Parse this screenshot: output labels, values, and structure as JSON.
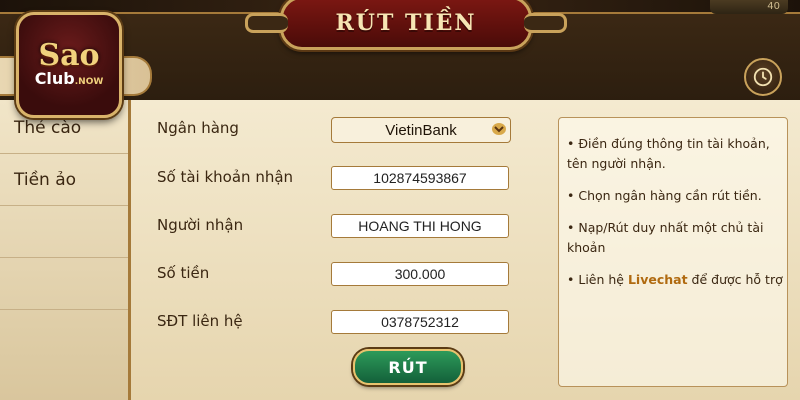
{
  "title": "RÚT TIỀN",
  "logo": {
    "main": "Sao",
    "sub": "Club",
    "suffix": ".NOW"
  },
  "top_badge": "40",
  "sidebar": {
    "items": [
      {
        "label": "Thẻ cào"
      },
      {
        "label": "Tiền ảo"
      }
    ]
  },
  "form": {
    "bank_label": "Ngân hàng",
    "bank_value": "VietinBank",
    "account_label": "Số tài khoản nhận",
    "account_value": "102874593867",
    "recipient_label": "Người nhận",
    "recipient_value": "HOANG THI HONG",
    "amount_label": "Số tiền",
    "amount_value": "300.000",
    "phone_label": "SĐT liên hệ",
    "phone_value": "0378752312",
    "submit_label": "RÚT"
  },
  "info": {
    "items": [
      "Điền đúng thông tin tài khoản, tên người nhận.",
      "Chọn ngân hàng cần rút tiền.",
      "Nạp/Rút duy nhất một chủ tài khoản"
    ],
    "last_prefix": "Liên hệ ",
    "last_highlight": "Livechat",
    "last_suffix": " để được hỗ trợ"
  },
  "colors": {
    "accent_gold": "#c9a25b",
    "title_red": "#7b1712",
    "submit_green": "#2d9a5a",
    "highlight": "#b06a10"
  },
  "icons": {
    "history": "history-clock-icon",
    "dropdown": "chevron-down-icon"
  }
}
